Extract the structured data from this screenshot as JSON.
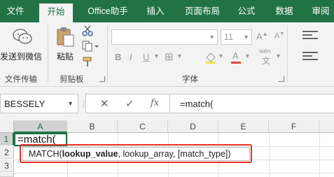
{
  "tabs": [
    {
      "label": "文件",
      "active": false
    },
    {
      "label": "开始",
      "active": true
    },
    {
      "label": "Office助手",
      "active": false
    },
    {
      "label": "插入",
      "active": false
    },
    {
      "label": "页面布局",
      "active": false
    },
    {
      "label": "公式",
      "active": false
    },
    {
      "label": "数据",
      "active": false
    },
    {
      "label": "审阅",
      "active": false
    }
  ],
  "ribbon": {
    "wechat_button": "发送到微信",
    "wechat_group": "文件传输",
    "paste_button": "粘贴",
    "clipboard_group": "剪贴板",
    "font_size": "11",
    "font_group": "字体",
    "wen_label": "wén"
  },
  "formula_bar": {
    "name_box": "BESSELY",
    "cancel_glyph": "✕",
    "enter_glyph": "✓",
    "fx_label": "fx",
    "formula": "=match("
  },
  "grid": {
    "columns": [
      "A",
      "B",
      "C",
      "D",
      "E",
      "F"
    ],
    "selected_column": "A",
    "rows": [
      "1",
      "2",
      "3"
    ],
    "selected_row": "1",
    "active_cell_text": "=match("
  },
  "tooltip": {
    "prefix": "MATCH(",
    "bold_arg": "lookup_value",
    "rest": ", lookup_array, [match_type])"
  },
  "colors": {
    "brand": "#217346",
    "highlight": "#e8312a"
  }
}
